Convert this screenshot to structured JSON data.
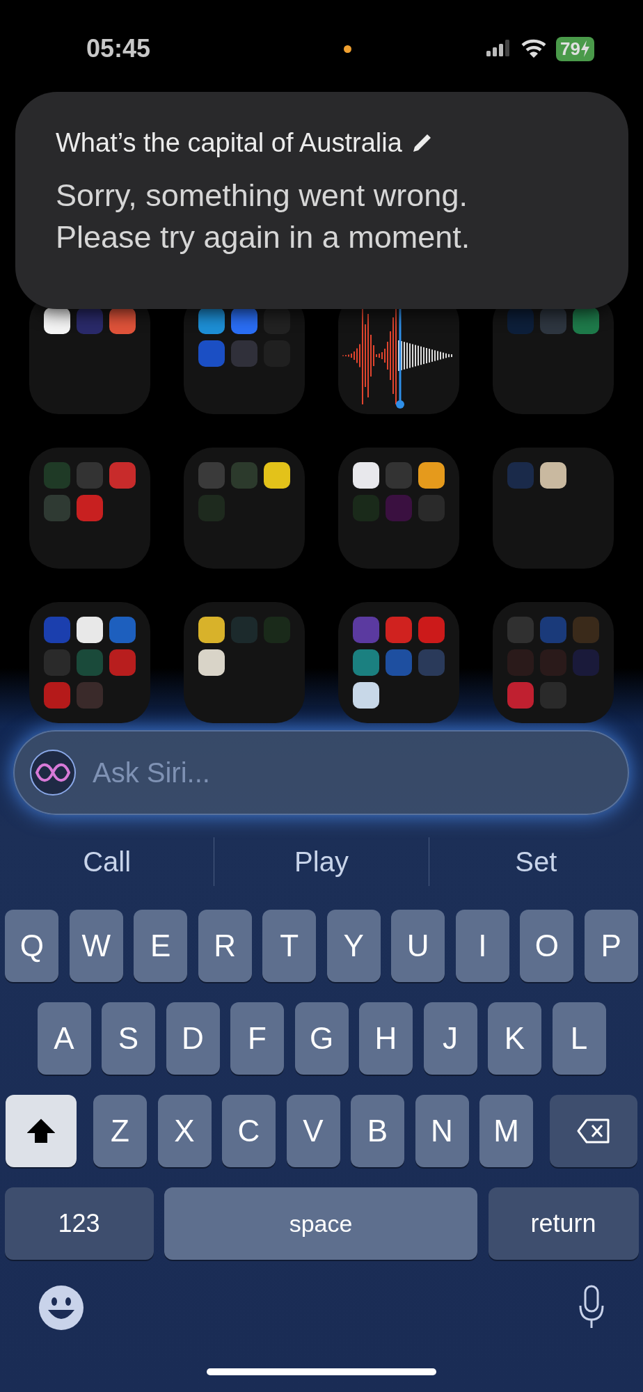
{
  "status_bar": {
    "time": "05:45",
    "battery": "79"
  },
  "siri_response": {
    "query": "What’s the capital of Australia",
    "message": "Sorry, something went wrong. Please try again in a moment."
  },
  "folders": [
    {
      "kind": "apps",
      "apps": [
        {
          "color": "#f5f5f5"
        },
        {
          "color": "#2a2a6a"
        },
        {
          "color": "#e0533a"
        }
      ]
    },
    {
      "kind": "apps",
      "apps": [
        {
          "color": "#1d8fd6"
        },
        {
          "color": "#2a6ef5"
        },
        {
          "color": "#222222"
        },
        {
          "color": "#1b4fc4"
        },
        {
          "color": "#30303a"
        },
        {
          "color": "#202020"
        }
      ]
    },
    {
      "kind": "waveform"
    },
    {
      "kind": "apps",
      "apps": [
        {
          "color": "#0d1f3a"
        },
        {
          "color": "#2e3640"
        },
        {
          "color": "#1e7a4a"
        }
      ]
    },
    {
      "kind": "apps",
      "apps": [
        {
          "color": "#1f3a26"
        },
        {
          "color": "#333333"
        },
        {
          "color": "#c82b2b"
        },
        {
          "color": "#2f3a33"
        },
        {
          "color": "#c82020"
        }
      ]
    },
    {
      "kind": "apps",
      "apps": [
        {
          "color": "#3a3a3a"
        },
        {
          "color": "#2c3a2c"
        },
        {
          "color": "#e3c21a"
        },
        {
          "color": "#1e2a1e"
        }
      ]
    },
    {
      "kind": "apps",
      "apps": [
        {
          "color": "#e8e8ec"
        },
        {
          "color": "#333333"
        },
        {
          "color": "#e59a1c"
        },
        {
          "color": "#1a2a1a"
        },
        {
          "color": "#3a1040"
        },
        {
          "color": "#2a2a2a"
        }
      ]
    },
    {
      "kind": "apps",
      "apps": [
        {
          "color": "#1a2a4a"
        },
        {
          "color": "#c9b9a0"
        }
      ]
    },
    {
      "kind": "apps",
      "apps": [
        {
          "color": "#1b3fae"
        },
        {
          "color": "#e8e8e8"
        },
        {
          "color": "#1d5fbe"
        },
        {
          "color": "#2a2a2a"
        },
        {
          "color": "#1a4a3a"
        },
        {
          "color": "#b81e1e"
        },
        {
          "color": "#b51a1a"
        },
        {
          "color": "#3a2a2a"
        }
      ]
    },
    {
      "kind": "apps",
      "apps": [
        {
          "color": "#d8b22a"
        },
        {
          "color": "#1c2a2c"
        },
        {
          "color": "#1a2a1a"
        },
        {
          "color": "#d9d4c8"
        }
      ]
    },
    {
      "kind": "apps",
      "apps": [
        {
          "color": "#5b3aa0"
        },
        {
          "color": "#d0221f"
        },
        {
          "color": "#cc1a1a"
        },
        {
          "color": "#1b8080"
        },
        {
          "color": "#1e4fa0"
        },
        {
          "color": "#2a3a5a"
        },
        {
          "color": "#c8d8e8"
        }
      ]
    },
    {
      "kind": "apps",
      "apps": [
        {
          "color": "#303030"
        },
        {
          "color": "#1a3a7a"
        },
        {
          "color": "#3a2a1a"
        },
        {
          "color": "#2a1a1a"
        },
        {
          "color": "#2a1a1a"
        },
        {
          "color": "#1a1a3a"
        },
        {
          "color": "#c02030"
        },
        {
          "color": "#2a2a2a"
        }
      ]
    }
  ],
  "siri_field": {
    "placeholder": "Ask Siri..."
  },
  "suggestions": [
    "Call",
    "Play",
    "Set"
  ],
  "keyboard": {
    "rows": [
      [
        "Q",
        "W",
        "E",
        "R",
        "T",
        "Y",
        "U",
        "I",
        "O",
        "P"
      ],
      [
        "A",
        "S",
        "D",
        "F",
        "G",
        "H",
        "J",
        "K",
        "L"
      ],
      [
        "Z",
        "X",
        "C",
        "V",
        "B",
        "N",
        "M"
      ]
    ],
    "shift": {
      "on": true
    },
    "numbers_key": "123",
    "space_key": "space",
    "return_key": "return"
  }
}
